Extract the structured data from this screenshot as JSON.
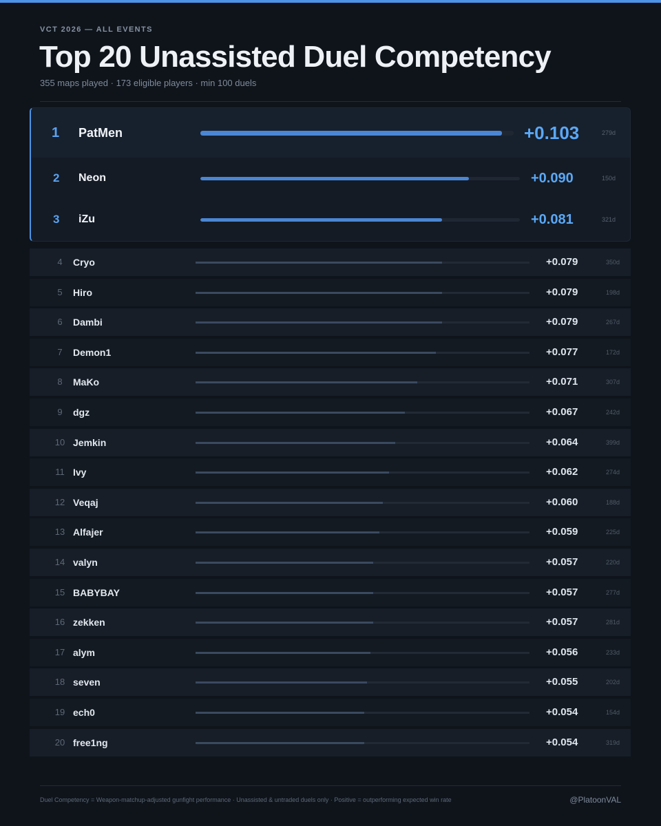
{
  "header": {
    "eyebrow": "VCT 2026 — ALL EVENTS",
    "title": "Top 20 Unassisted Duel Competency",
    "subtitle": "355 maps played · 173 eligible players · min 100 duels"
  },
  "footer": {
    "note": "Duel Competency = Weapon-matchup-adjusted gunfight performance · Unassisted & untraded duels only · Positive = outperforming expected win rate",
    "handle": "@PlatoonVAL"
  },
  "colors": {
    "accent": "#4d93e6",
    "podium_value": "#5aa8f7",
    "background": "#0f141b"
  },
  "chart_data": {
    "type": "bar",
    "title": "Top 20 Unassisted Duel Competency",
    "orientation": "horizontal",
    "xlim": [
      0,
      0.107
    ],
    "categories": [
      "PatMen",
      "Neon",
      "iZu",
      "Cryo",
      "Hiro",
      "Dambi",
      "Demon1",
      "MaKo",
      "dgz",
      "Jemkin",
      "Ivy",
      "Veqaj",
      "Alfajer",
      "valyn",
      "BABYBAY",
      "zekken",
      "alym",
      "seven",
      "ech0",
      "free1ng"
    ],
    "rows": [
      {
        "rank": "1",
        "player": "PatMen",
        "value": 0.103,
        "value_label": "+0.103",
        "duels": "279d"
      },
      {
        "rank": "2",
        "player": "Neon",
        "value": 0.09,
        "value_label": "+0.090",
        "duels": "150d"
      },
      {
        "rank": "3",
        "player": "iZu",
        "value": 0.081,
        "value_label": "+0.081",
        "duels": "321d"
      },
      {
        "rank": "4",
        "player": "Cryo",
        "value": 0.079,
        "value_label": "+0.079",
        "duels": "350d"
      },
      {
        "rank": "5",
        "player": "Hiro",
        "value": 0.079,
        "value_label": "+0.079",
        "duels": "198d"
      },
      {
        "rank": "6",
        "player": "Dambi",
        "value": 0.079,
        "value_label": "+0.079",
        "duels": "267d"
      },
      {
        "rank": "7",
        "player": "Demon1",
        "value": 0.077,
        "value_label": "+0.077",
        "duels": "172d"
      },
      {
        "rank": "8",
        "player": "MaKo",
        "value": 0.071,
        "value_label": "+0.071",
        "duels": "307d"
      },
      {
        "rank": "9",
        "player": "dgz",
        "value": 0.067,
        "value_label": "+0.067",
        "duels": "242d"
      },
      {
        "rank": "10",
        "player": "Jemkin",
        "value": 0.064,
        "value_label": "+0.064",
        "duels": "399d"
      },
      {
        "rank": "11",
        "player": "Ivy",
        "value": 0.062,
        "value_label": "+0.062",
        "duels": "274d"
      },
      {
        "rank": "12",
        "player": "Veqaj",
        "value": 0.06,
        "value_label": "+0.060",
        "duels": "188d"
      },
      {
        "rank": "13",
        "player": "Alfajer",
        "value": 0.059,
        "value_label": "+0.059",
        "duels": "225d"
      },
      {
        "rank": "14",
        "player": "valyn",
        "value": 0.057,
        "value_label": "+0.057",
        "duels": "220d"
      },
      {
        "rank": "15",
        "player": "BABYBAY",
        "value": 0.057,
        "value_label": "+0.057",
        "duels": "277d"
      },
      {
        "rank": "16",
        "player": "zekken",
        "value": 0.057,
        "value_label": "+0.057",
        "duels": "281d"
      },
      {
        "rank": "17",
        "player": "alym",
        "value": 0.056,
        "value_label": "+0.056",
        "duels": "233d"
      },
      {
        "rank": "18",
        "player": "seven",
        "value": 0.055,
        "value_label": "+0.055",
        "duels": "202d"
      },
      {
        "rank": "19",
        "player": "ech0",
        "value": 0.054,
        "value_label": "+0.054",
        "duels": "154d"
      },
      {
        "rank": "20",
        "player": "free1ng",
        "value": 0.054,
        "value_label": "+0.054",
        "duels": "319d"
      }
    ]
  }
}
